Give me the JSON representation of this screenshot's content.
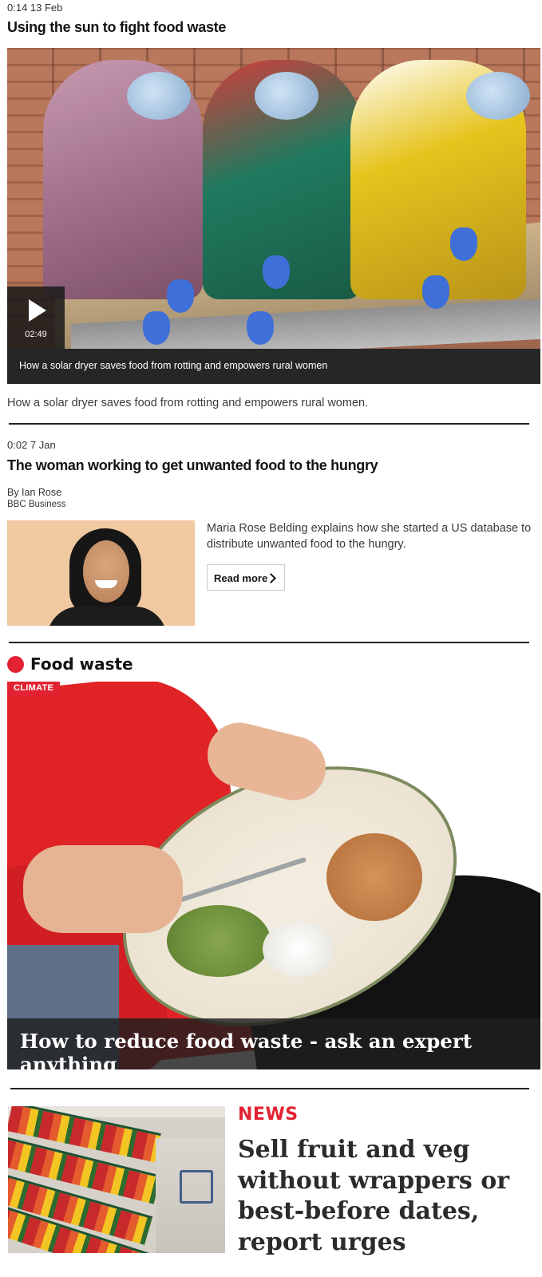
{
  "story1": {
    "meta": "0:14 13 Feb",
    "title": "Using the sun to fight food waste",
    "video": {
      "duration": "02:49",
      "caption": "How a solar dryer saves food from rotting and empowers rural women"
    },
    "summary": "How a solar dryer saves food from rotting and empowers rural women."
  },
  "story2": {
    "meta": "0:02 7 Jan",
    "title": "The woman working to get unwanted food to the hungry",
    "byline": "By Ian Rose",
    "source": "BBC Business",
    "summary": "Maria Rose Belding explains how she started a US database to distribute unwanted food to the hungry.",
    "read_more_label": "Read more"
  },
  "food_waste": {
    "section_title": "Food waste",
    "tag": "CLIMATE",
    "headline": "How to reduce food waste - ask an expert anything"
  },
  "news": {
    "label": "NEWS",
    "headline": "Sell fruit and veg without wrappers or best-before dates, report urges"
  },
  "colors": {
    "accent_red": "#e22232",
    "caption_bar": "#262626",
    "divider": "#222222"
  },
  "icons": [
    "play-icon",
    "chevron-right-icon",
    "section-dot-icon"
  ]
}
